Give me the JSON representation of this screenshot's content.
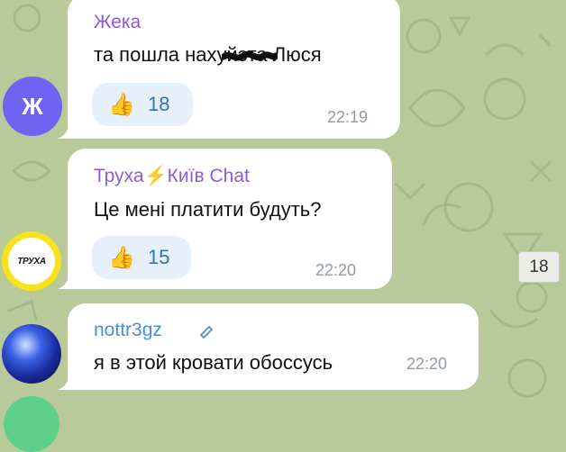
{
  "messages": [
    {
      "sender": "Жека",
      "text_before": "та пошла на",
      "text_hidden": "хуй",
      "text_after": "эта Люся",
      "reaction_emoji": "👍",
      "reaction_count": "18",
      "time": "22:19",
      "avatar_letter": "Ж",
      "avatar_color": "#6f63f2"
    },
    {
      "sender": "Труха⚡Київ Chat",
      "text": "Це мені платити будуть?",
      "reaction_emoji": "👍",
      "reaction_count": "15",
      "time": "22:20",
      "avatar_label": "ТРУХА"
    },
    {
      "sender": "nottr3gz",
      "text": "я в этой кровати обоссусь",
      "time": "22:20"
    }
  ],
  "unread_badge": "18",
  "colors": {
    "background": "#b9c99a",
    "sender": "#8e5bd6",
    "reaction_bg": "#e6f0fb",
    "reaction_count": "#3d6fb0",
    "time": "#8f9aa5"
  }
}
